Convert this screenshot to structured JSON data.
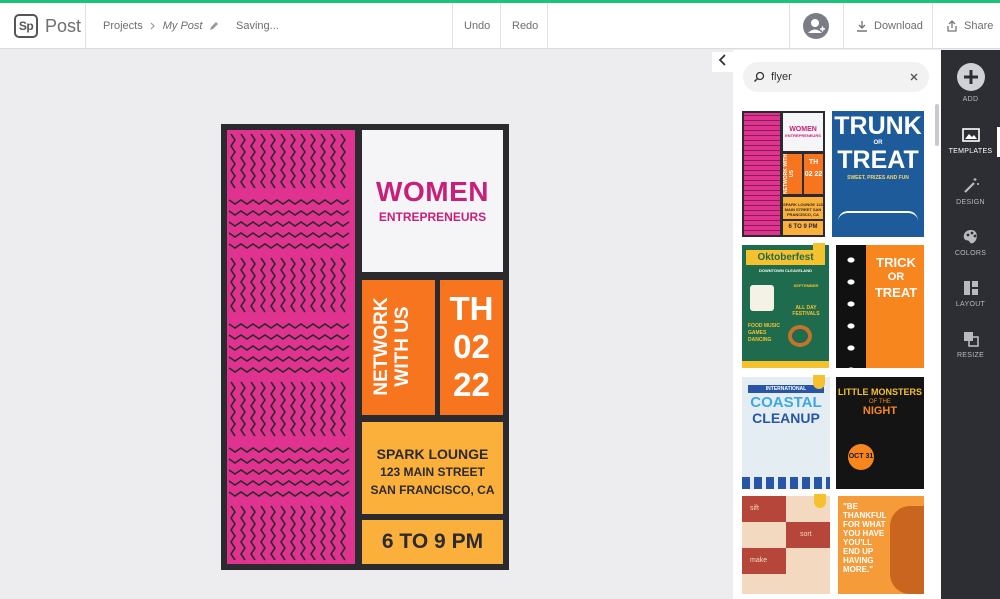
{
  "colors": {
    "accent_green": "#1ec07a",
    "pink": "#e0338f",
    "orange": "#f8751f",
    "yellow": "#fbb03b",
    "dark": "#2b2a2e",
    "rail": "#2d2e33"
  },
  "header": {
    "logo_badge": "Sp",
    "logo_text": "Post",
    "breadcrumb_root": "Projects",
    "project_name": "My Post",
    "status": "Saving...",
    "undo": "Undo",
    "redo": "Redo",
    "download": "Download",
    "share": "Share"
  },
  "icons": [
    "sparkpost-logo",
    "chevron-right-icon",
    "pencil-icon",
    "user-add-icon",
    "download-icon",
    "share-icon",
    "collapse-icon",
    "search-icon",
    "clear-icon",
    "plus-icon",
    "templates-icon",
    "magic-wand-icon",
    "palette-icon",
    "layout-icon",
    "resize-icon",
    "premium-crown-icon"
  ],
  "search": {
    "value": "flyer"
  },
  "rail": {
    "add": "ADD",
    "templates": "TEMPLATES",
    "design": "DESIGN",
    "colors": "COLORS",
    "layout": "LAYOUT",
    "resize": "RESIZE"
  },
  "poster": {
    "line1": "WOMEN",
    "line2": "ENTREPRENEURS",
    "network": "NETWORK",
    "with_us": "WITH US",
    "day": "TH",
    "month": "02",
    "date": "22",
    "venue": "SPARK LOUNGE",
    "street": "123 MAIN STREET",
    "city": "SAN FRANCISCO, CA",
    "time": "6 TO 9 PM"
  },
  "templates": {
    "t1": {
      "l1": "WOMEN",
      "l2": "ENTREPRENEURS",
      "l3": "NETWORK WITH US",
      "l4": "TH 02 22",
      "l5": "SPARK LOUNGE 123 MAIN STREET SAN FRANCISCO, CA",
      "l6": "6 TO 9 PM"
    },
    "t2": {
      "l1": "TRUNK",
      "l2": "OR",
      "l3": "TREAT",
      "l4": "SWEET, PRIZES AND FUN"
    },
    "t3": {
      "l1": "Oktoberfest",
      "l2": "DOWNTOWN CLEAVELAND",
      "l3": "SEPTEMBER",
      "l4": "ALL DAY FESTIVALS",
      "l5": "FOOD MUSIC GAMES DANCING"
    },
    "t4": {
      "l1": "TRICK",
      "l2": "OR",
      "l3": "TREAT"
    },
    "t5": {
      "l1": "INTERNATIONAL",
      "l2": "COASTAL",
      "l3": "CLEANUP"
    },
    "t6": {
      "l1": "LITTLE MONSTERS",
      "l2": "OF THE",
      "l3": "NIGHT",
      "l4": "OCT 31"
    },
    "t7": {
      "l1": "sift",
      "l2": "sort",
      "l3": "make"
    },
    "t8": {
      "l1": "\"BE",
      "l2": "THANKFUL",
      "l3": "FOR WHAT",
      "l4": "YOU HAVE",
      "l5": "YOU'LL",
      "l6": "END UP",
      "l7": "HAVING",
      "l8": "MORE.\""
    }
  }
}
